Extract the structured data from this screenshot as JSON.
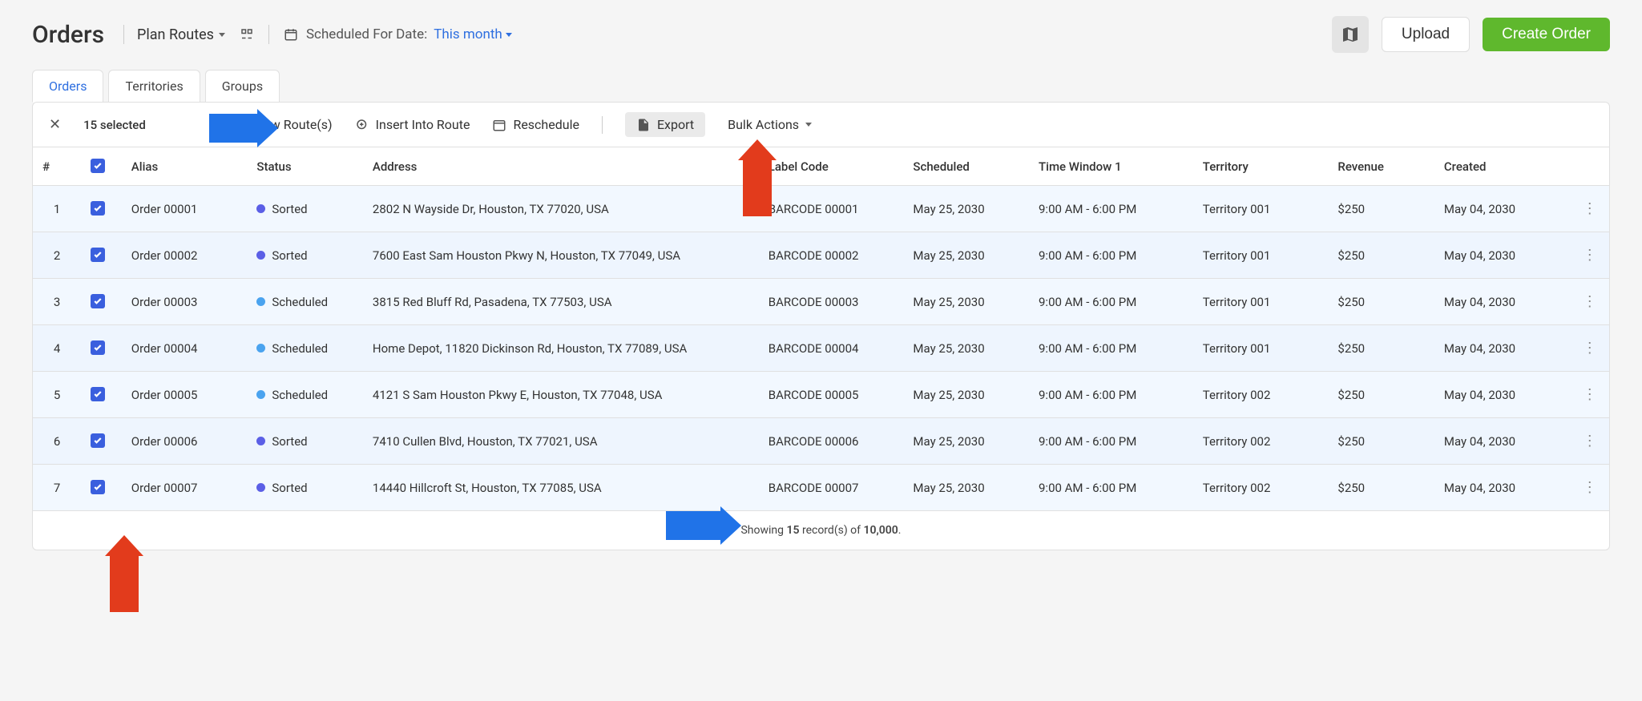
{
  "header": {
    "title": "Orders",
    "plan_routes": "Plan Routes",
    "scheduled_label": "Scheduled For Date:",
    "scheduled_value": "This month",
    "upload": "Upload",
    "create": "Create Order"
  },
  "tabs": [
    "Orders",
    "Territories",
    "Groups"
  ],
  "toolbar": {
    "selected": "15 selected",
    "new_routes": "w Route(s)",
    "insert": "Insert Into Route",
    "reschedule": "Reschedule",
    "export": "Export",
    "bulk": "Bulk Actions"
  },
  "columns": [
    "#",
    "",
    "Alias",
    "Status",
    "Address",
    "Label Code",
    "Scheduled",
    "Time Window 1",
    "Territory",
    "Revenue",
    "Created",
    ""
  ],
  "rows": [
    {
      "n": "1",
      "alias": "Order 00001",
      "status": "Sorted",
      "status_kind": "sorted",
      "address": "2802 N Wayside Dr, Houston, TX 77020, USA",
      "code": "BARCODE 00001",
      "sched": "May 25, 2030",
      "tw": "9:00 AM - 6:00 PM",
      "terr": "Territory 001",
      "rev": "$250",
      "created": "May 04, 2030"
    },
    {
      "n": "2",
      "alias": "Order 00002",
      "status": "Sorted",
      "status_kind": "sorted",
      "address": "7600 East Sam Houston Pkwy N, Houston, TX 77049, USA",
      "code": "BARCODE 00002",
      "sched": "May 25, 2030",
      "tw": "9:00 AM - 6:00 PM",
      "terr": "Territory 001",
      "rev": "$250",
      "created": "May 04, 2030"
    },
    {
      "n": "3",
      "alias": "Order 00003",
      "status": "Scheduled",
      "status_kind": "scheduled",
      "address": "3815 Red Bluff Rd, Pasadena, TX 77503, USA",
      "code": "BARCODE 00003",
      "sched": "May 25, 2030",
      "tw": "9:00 AM - 6:00 PM",
      "terr": "Territory 001",
      "rev": "$250",
      "created": "May 04, 2030"
    },
    {
      "n": "4",
      "alias": "Order 00004",
      "status": "Scheduled",
      "status_kind": "scheduled",
      "address": "Home Depot, 11820 Dickinson Rd, Houston, TX 77089, USA",
      "code": "BARCODE 00004",
      "sched": "May 25, 2030",
      "tw": "9:00 AM - 6:00 PM",
      "terr": "Territory 001",
      "rev": "$250",
      "created": "May 04, 2030"
    },
    {
      "n": "5",
      "alias": "Order 00005",
      "status": "Scheduled",
      "status_kind": "scheduled",
      "address": "4121 S Sam Houston Pkwy E, Houston, TX 77048, USA",
      "code": "BARCODE 00005",
      "sched": "May 25, 2030",
      "tw": "9:00 AM - 6:00 PM",
      "terr": "Territory 002",
      "rev": "$250",
      "created": "May 04, 2030"
    },
    {
      "n": "6",
      "alias": "Order 00006",
      "status": "Sorted",
      "status_kind": "sorted",
      "address": "7410 Cullen Blvd, Houston, TX 77021, USA",
      "code": "BARCODE 00006",
      "sched": "May 25, 2030",
      "tw": "9:00 AM - 6:00 PM",
      "terr": "Territory 002",
      "rev": "$250",
      "created": "May 04, 2030"
    },
    {
      "n": "7",
      "alias": "Order 00007",
      "status": "Sorted",
      "status_kind": "sorted",
      "address": "14440 Hillcroft St, Houston, TX 77085, USA",
      "code": "BARCODE 00007",
      "sched": "May 25, 2030",
      "tw": "9:00 AM - 6:00 PM",
      "terr": "Territory 002",
      "rev": "$250",
      "created": "May 04, 2030"
    }
  ],
  "footer": {
    "prefix": "Showing ",
    "count": "15",
    "mid": " record(s) of ",
    "total": "10,000",
    "suffix": "."
  }
}
